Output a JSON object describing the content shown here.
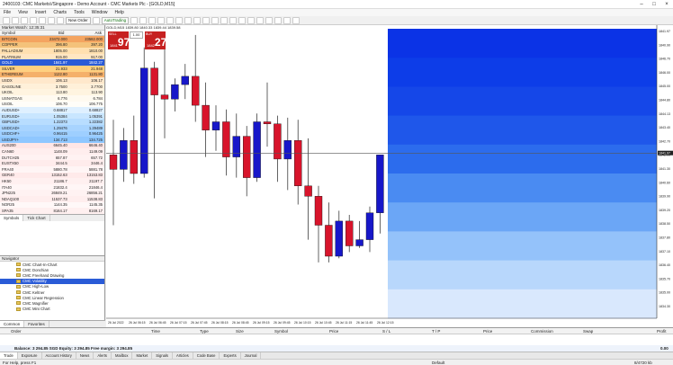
{
  "window": {
    "title": "2400103: CMC Markets\\/Singapore - Demo Account - CMC Markets Plc - [GOLD,M15]"
  },
  "menu": [
    "File",
    "View",
    "Insert",
    "Charts",
    "Tools",
    "Window",
    "Help"
  ],
  "toolbar": {
    "new_order": "New Order",
    "autotrading": "AutoTrading"
  },
  "market_watch": {
    "title": "Market Watch: 12:35:31",
    "columns": [
      "Symbol",
      "Bid",
      "Ask"
    ],
    "rows": [
      {
        "s": "BITCOIN",
        "b": "23472.000",
        "a": "23582.000",
        "c": "#f4a460"
      },
      {
        "s": "COPPER",
        "b": "396.80",
        "a": "397.20",
        "c": "#f4c27a"
      },
      {
        "s": "PALLADIUM",
        "b": "1805.00",
        "a": "1810.00",
        "c": "#ffe0b0"
      },
      {
        "s": "PLATINUM",
        "b": "915.00",
        "a": "917.00",
        "c": "#ffe6c2"
      },
      {
        "s": "GOLD",
        "b": "1841.97",
        "a": "1842.27",
        "c": "#2a5bd7",
        "sel": true
      },
      {
        "s": "SILVER",
        "b": "21.933",
        "a": "21.948",
        "c": "#ffd080"
      },
      {
        "s": "ETHEREUM",
        "b": "1122.80",
        "a": "1131.80",
        "c": "#f5b06a"
      },
      {
        "s": "USDX",
        "b": "106.13",
        "a": "106.17",
        "c": "#ffe8cc"
      },
      {
        "s": "GASOLINE",
        "b": "3.7500",
        "a": "3.7700",
        "c": "#fff0d9"
      },
      {
        "s": "UKOIL",
        "b": "113.80",
        "a": "113.90",
        "c": "#fff4e0"
      },
      {
        "s": "USNATGAS",
        "b": "6.776",
        "a": "6.784",
        "c": "#fffaf0"
      },
      {
        "s": "USOIL",
        "b": "106.70",
        "a": "106.775",
        "c": "#fffdf8"
      },
      {
        "s": "AUDUSD+",
        "b": "0.68817",
        "a": "0.68827",
        "c": "#dff0ff"
      },
      {
        "s": "EURUSD+",
        "b": "1.05384",
        "a": "1.05391",
        "c": "#c9e6ff"
      },
      {
        "s": "GBPUSD+",
        "b": "1.22373",
        "a": "1.22382",
        "c": "#b8ddff"
      },
      {
        "s": "USDCAD+",
        "b": "1.29476",
        "a": "1.29489",
        "c": "#a8d4ff"
      },
      {
        "s": "USDCHF+",
        "b": "0.96415",
        "a": "0.96425",
        "c": "#9ecfff"
      },
      {
        "s": "USDJPY+",
        "b": "134.713",
        "a": "134.725",
        "c": "#8fc7ff"
      },
      {
        "s": "AUS200",
        "b": "6645.40",
        "a": "6646.40",
        "c": "#ffe6e6"
      },
      {
        "s": "CAN60",
        "b": "1148.09",
        "a": "1149.09",
        "c": "#ffeeee"
      },
      {
        "s": "DUTCH25",
        "b": "657.87",
        "a": "657.72",
        "c": "#fff2f2"
      },
      {
        "s": "EUSTX50",
        "b": "3444.5",
        "a": "3446.4",
        "c": "#ffecec"
      },
      {
        "s": "FRA40",
        "b": "5880.78",
        "a": "5881.78",
        "c": "#fff5f5"
      },
      {
        "s": "GER40",
        "b": "13152.63",
        "a": "13153.83",
        "c": "#ffeaea"
      },
      {
        "s": "HK50",
        "b": "21186.7",
        "a": "21197.7",
        "c": "#fff0f0"
      },
      {
        "s": "ITA40",
        "b": "21832.4",
        "a": "21846.4",
        "c": "#fff6f6"
      },
      {
        "s": "JPN225",
        "b": "26849.21",
        "a": "26856.21",
        "c": "#fff2f2"
      },
      {
        "s": "NDAQ100",
        "b": "11537.73",
        "a": "11538.83",
        "c": "#ffeeee"
      },
      {
        "s": "NOR25",
        "b": "1144.35",
        "a": "1145.35",
        "c": "#fff8f8"
      },
      {
        "s": "SPA35",
        "b": "8164.17",
        "a": "8169.17",
        "c": "#fff0f0"
      }
    ],
    "tabs": [
      "Symbols",
      "Tick Chart"
    ]
  },
  "navigator": {
    "title": "Navigator",
    "items": [
      "CMC Chart-In-Chart",
      "CMC Donchian",
      "CMC Freehand Drawing",
      "CMC Volatility",
      "CMC High-Low",
      "CMC Keltner",
      "CMC Linear Regression",
      "CMC Magnifier",
      "CMC Mini Chart"
    ],
    "selected": 3,
    "tabs": [
      "Common",
      "Favorites"
    ]
  },
  "chart": {
    "symbol_header": "GOLD,M15  1839.80 1840.33 1839.44 1839.58",
    "sell": {
      "label": "SELL",
      "big": "97",
      "small": "1841"
    },
    "buy": {
      "label": "BUY",
      "big": "27",
      "small": "1842"
    },
    "lot": "1.00",
    "price_labels": [
      "1841.97",
      "1840.90",
      "1846.70",
      "1846.00",
      "1845.00",
      "1844.80",
      "1844.13",
      "1843.40",
      "1842.70",
      "1842.00",
      "1841.30",
      "1840.60",
      "1839.90",
      "1839.20",
      "1838.50",
      "1837.80",
      "1837.10",
      "1836.40",
      "1835.70",
      "1835.00",
      "1834.30"
    ],
    "current_price": "1841.97",
    "time_labels": [
      "26 Jul 2022",
      "26 Jul 06:15",
      "26 Jul 06:45",
      "26 Jul 07:15",
      "26 Jul 07:45",
      "26 Jul 08:15",
      "26 Jul 08:45",
      "26 Jul 09:15",
      "26 Jul 09:45",
      "26 Jul 10:15",
      "26 Jul 10:45",
      "26 Jul 11:15",
      "26 Jul 11:45",
      "26 Jul 12:15"
    ],
    "candles": [
      {
        "o": 1841.9,
        "h": 1843.6,
        "l": 1838.5,
        "c": 1841.2
      },
      {
        "o": 1841.2,
        "h": 1843.2,
        "l": 1840.6,
        "c": 1842.6
      },
      {
        "o": 1842.6,
        "h": 1843.8,
        "l": 1840.5,
        "c": 1841.0
      },
      {
        "o": 1841.0,
        "h": 1847.1,
        "l": 1840.8,
        "c": 1846.1
      },
      {
        "o": 1846.1,
        "h": 1846.4,
        "l": 1839.8,
        "c": 1844.8
      },
      {
        "o": 1844.8,
        "h": 1847.2,
        "l": 1842.7,
        "c": 1844.6
      },
      {
        "o": 1844.6,
        "h": 1845.6,
        "l": 1844.0,
        "c": 1845.3
      },
      {
        "o": 1845.3,
        "h": 1846.3,
        "l": 1844.6,
        "c": 1845.7
      },
      {
        "o": 1845.7,
        "h": 1847.7,
        "l": 1843.5,
        "c": 1844.3
      },
      {
        "o": 1844.3,
        "h": 1845.4,
        "l": 1841.8,
        "c": 1843.1
      },
      {
        "o": 1843.1,
        "h": 1844.3,
        "l": 1842.1,
        "c": 1843.5
      },
      {
        "o": 1843.5,
        "h": 1844.1,
        "l": 1840.9,
        "c": 1841.8
      },
      {
        "o": 1841.8,
        "h": 1843.9,
        "l": 1840.8,
        "c": 1842.8
      },
      {
        "o": 1842.8,
        "h": 1843.3,
        "l": 1839.9,
        "c": 1840.8
      },
      {
        "o": 1840.8,
        "h": 1843.9,
        "l": 1840.6,
        "c": 1843.5
      },
      {
        "o": 1843.5,
        "h": 1845.4,
        "l": 1842.3,
        "c": 1843.4
      },
      {
        "o": 1843.4,
        "h": 1843.8,
        "l": 1840.6,
        "c": 1841.7
      },
      {
        "o": 1841.7,
        "h": 1843.7,
        "l": 1840.2,
        "c": 1842.6
      },
      {
        "o": 1842.6,
        "h": 1843.6,
        "l": 1839.5,
        "c": 1840.4
      },
      {
        "o": 1840.4,
        "h": 1842.7,
        "l": 1837.8,
        "c": 1839.9
      },
      {
        "o": 1839.9,
        "h": 1840.4,
        "l": 1836.7,
        "c": 1838.5
      },
      {
        "o": 1838.5,
        "h": 1839.6,
        "l": 1836.7,
        "c": 1837.0
      },
      {
        "o": 1837.0,
        "h": 1839.2,
        "l": 1836.9,
        "c": 1838.7
      },
      {
        "o": 1838.7,
        "h": 1839.0,
        "l": 1837.2,
        "c": 1837.5
      },
      {
        "o": 1837.5,
        "h": 1838.7,
        "l": 1837.4,
        "c": 1837.8
      },
      {
        "o": 1837.8,
        "h": 1839.4,
        "l": 1837.2,
        "c": 1839.1
      },
      {
        "o": 1839.1,
        "h": 1841.9,
        "l": 1838.1,
        "c": 1841.9
      }
    ],
    "ylim": [
      1834.0,
      1848.0
    ],
    "volume_profile_colors": [
      "#0b33e6",
      "#0d3de8",
      "#1547e8",
      "#1f57ea",
      "#2c6ced",
      "#4a8bf2",
      "#6ba6f6",
      "#94c2fa",
      "#b8d7fc",
      "#d9e8fd"
    ]
  },
  "terminal": {
    "columns": [
      "Order",
      "Time",
      "Type",
      "Size",
      "Symbol",
      "Price",
      "S / L",
      "T / P",
      "Price",
      "Commission",
      "Swap",
      "Profit"
    ],
    "balance": "Balance: 3 294.85 SGD  Equity: 3 294.85  Free margin: 3 294.85",
    "profit": "0.00",
    "tabs": [
      "Trade",
      "Exposure",
      "Account History",
      "News",
      "Alerts",
      "Mailbox",
      "Market",
      "Signals",
      "Articles",
      "Code Base",
      "Experts",
      "Journal"
    ]
  },
  "statusbar": {
    "help": "For Help, press F1",
    "profile": "Default",
    "traffic": "8/4720 kb"
  }
}
